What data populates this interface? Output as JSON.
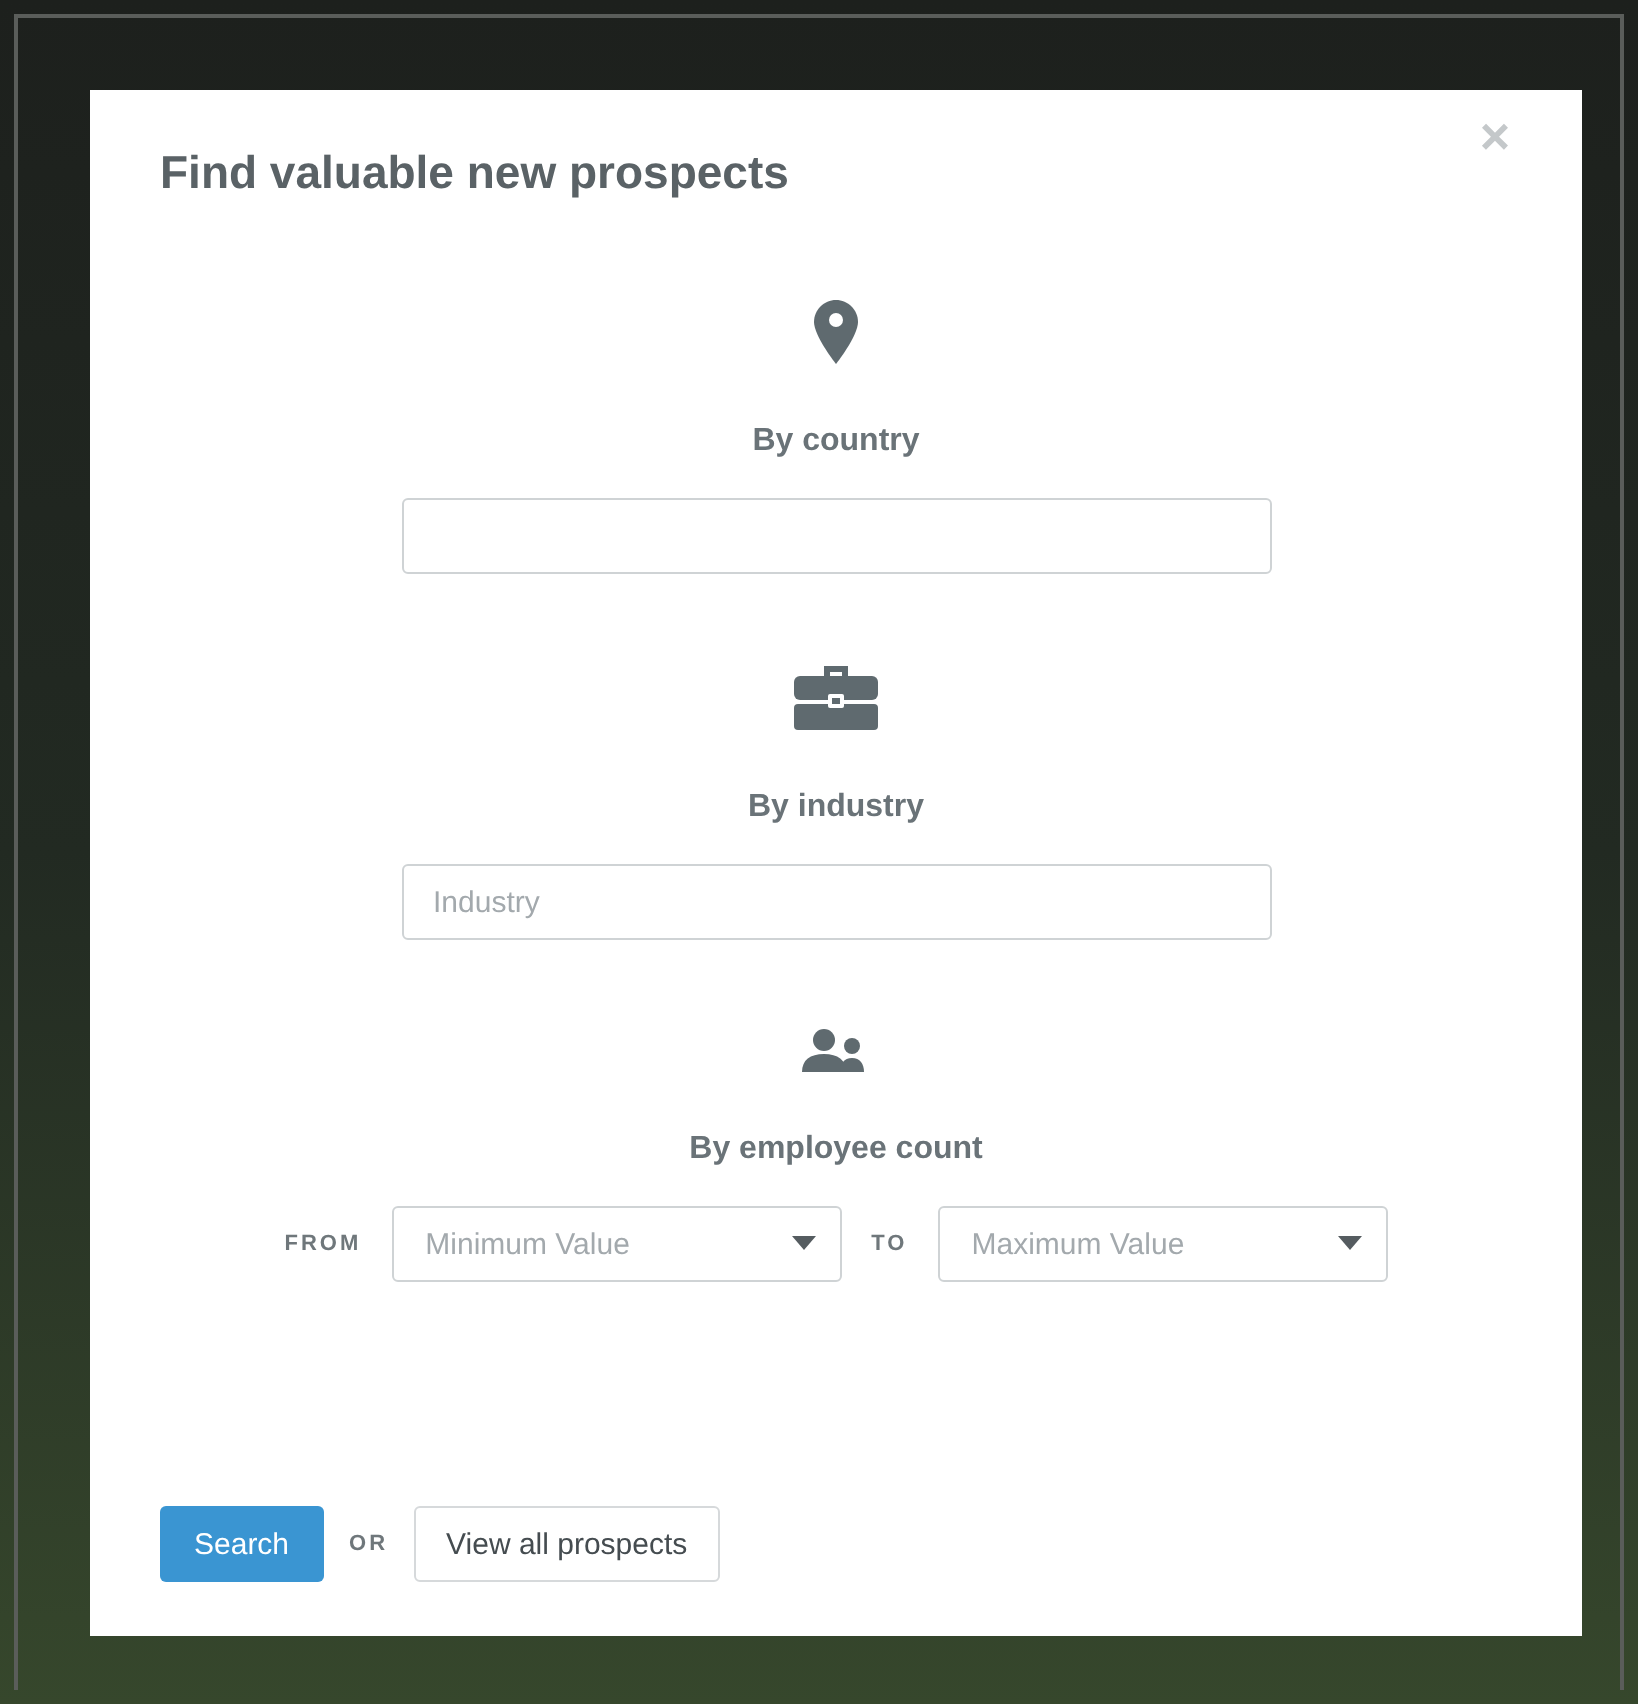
{
  "dialog": {
    "title": "Find valuable new prospects",
    "close": "×"
  },
  "filters": [
    {
      "kind": "text",
      "label": "By country"
    },
    {
      "kind": "text",
      "label": "By industry",
      "field": {
        "placeholder": "Industry"
      }
    },
    {
      "kind": "range",
      "label": "By employee count",
      "from_label": "FROM",
      "from": {
        "placeholder": "Minimum Value"
      },
      "to_label": "TO",
      "to": {
        "placeholder": "Maximum Value"
      }
    }
  ],
  "actions": {
    "primary": "Search",
    "separator": "OR",
    "secondary": "View all prospects"
  }
}
